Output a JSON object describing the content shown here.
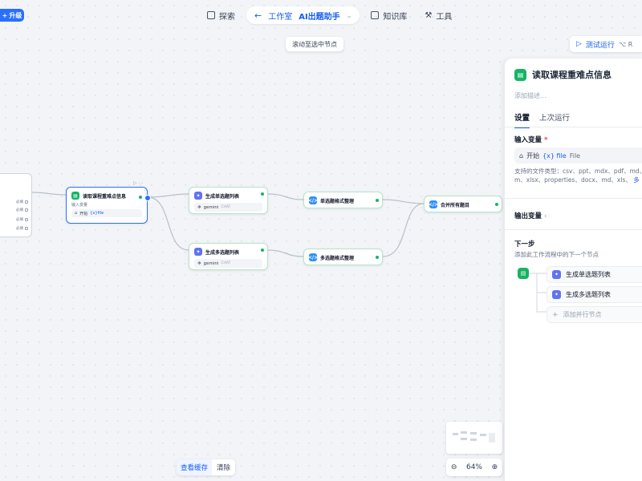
{
  "top": {
    "upgrade_label": "升级",
    "explore_label": "探索",
    "studio_label": "工作室",
    "app_name": "AI出题助手",
    "knowledge_label": "知识库",
    "tools_label": "工具"
  },
  "canvas": {
    "scroll_tip": "滚动至选中节点",
    "test_run_label": "测试运行",
    "test_run_shortcut": "⌥ R",
    "zoom_level": "64%",
    "view_cache_label": "查看缓存",
    "clear_label": "清除"
  },
  "nodes": {
    "read": {
      "title": "读取课程重难点信息",
      "input_label": "输入变量",
      "input_source": "开始",
      "input_var": "{x}file"
    },
    "gen_single": {
      "title": "生成单选题列表",
      "model": "gemini",
      "tag": "CHAT"
    },
    "gen_multi": {
      "title": "生成多选题列表",
      "model": "gemini",
      "tag": "CHAT"
    },
    "fmt_single": {
      "title": "单选题格式整理"
    },
    "fmt_multi": {
      "title": "多选题格式整理"
    },
    "merge": {
      "title": "合并所有题目"
    },
    "left_stub_rows": [
      "必填",
      "必填",
      "必填",
      "必填"
    ]
  },
  "panel": {
    "title": "读取课程重难点信息",
    "description_placeholder": "添加描述...",
    "tab_settings": "设置",
    "tab_last_run": "上次运行",
    "input_vars_label": "输入变量",
    "required_mark": "*",
    "input_source": "开始",
    "input_var": "{x} file",
    "input_type": "File",
    "help_text": "支持的文件类型：csv、ppt、mdx、pdf、md、htm、xlsx、properties、docx、md、xls、",
    "help_more": "多",
    "output_vars_label": "输出变量",
    "next_step_label": "下一步",
    "next_step_desc": "添加此工作流程中的下一个节点",
    "next_items": [
      "生成单选题列表",
      "生成多选题列表"
    ],
    "add_parallel_label": "添加并行节点"
  }
}
